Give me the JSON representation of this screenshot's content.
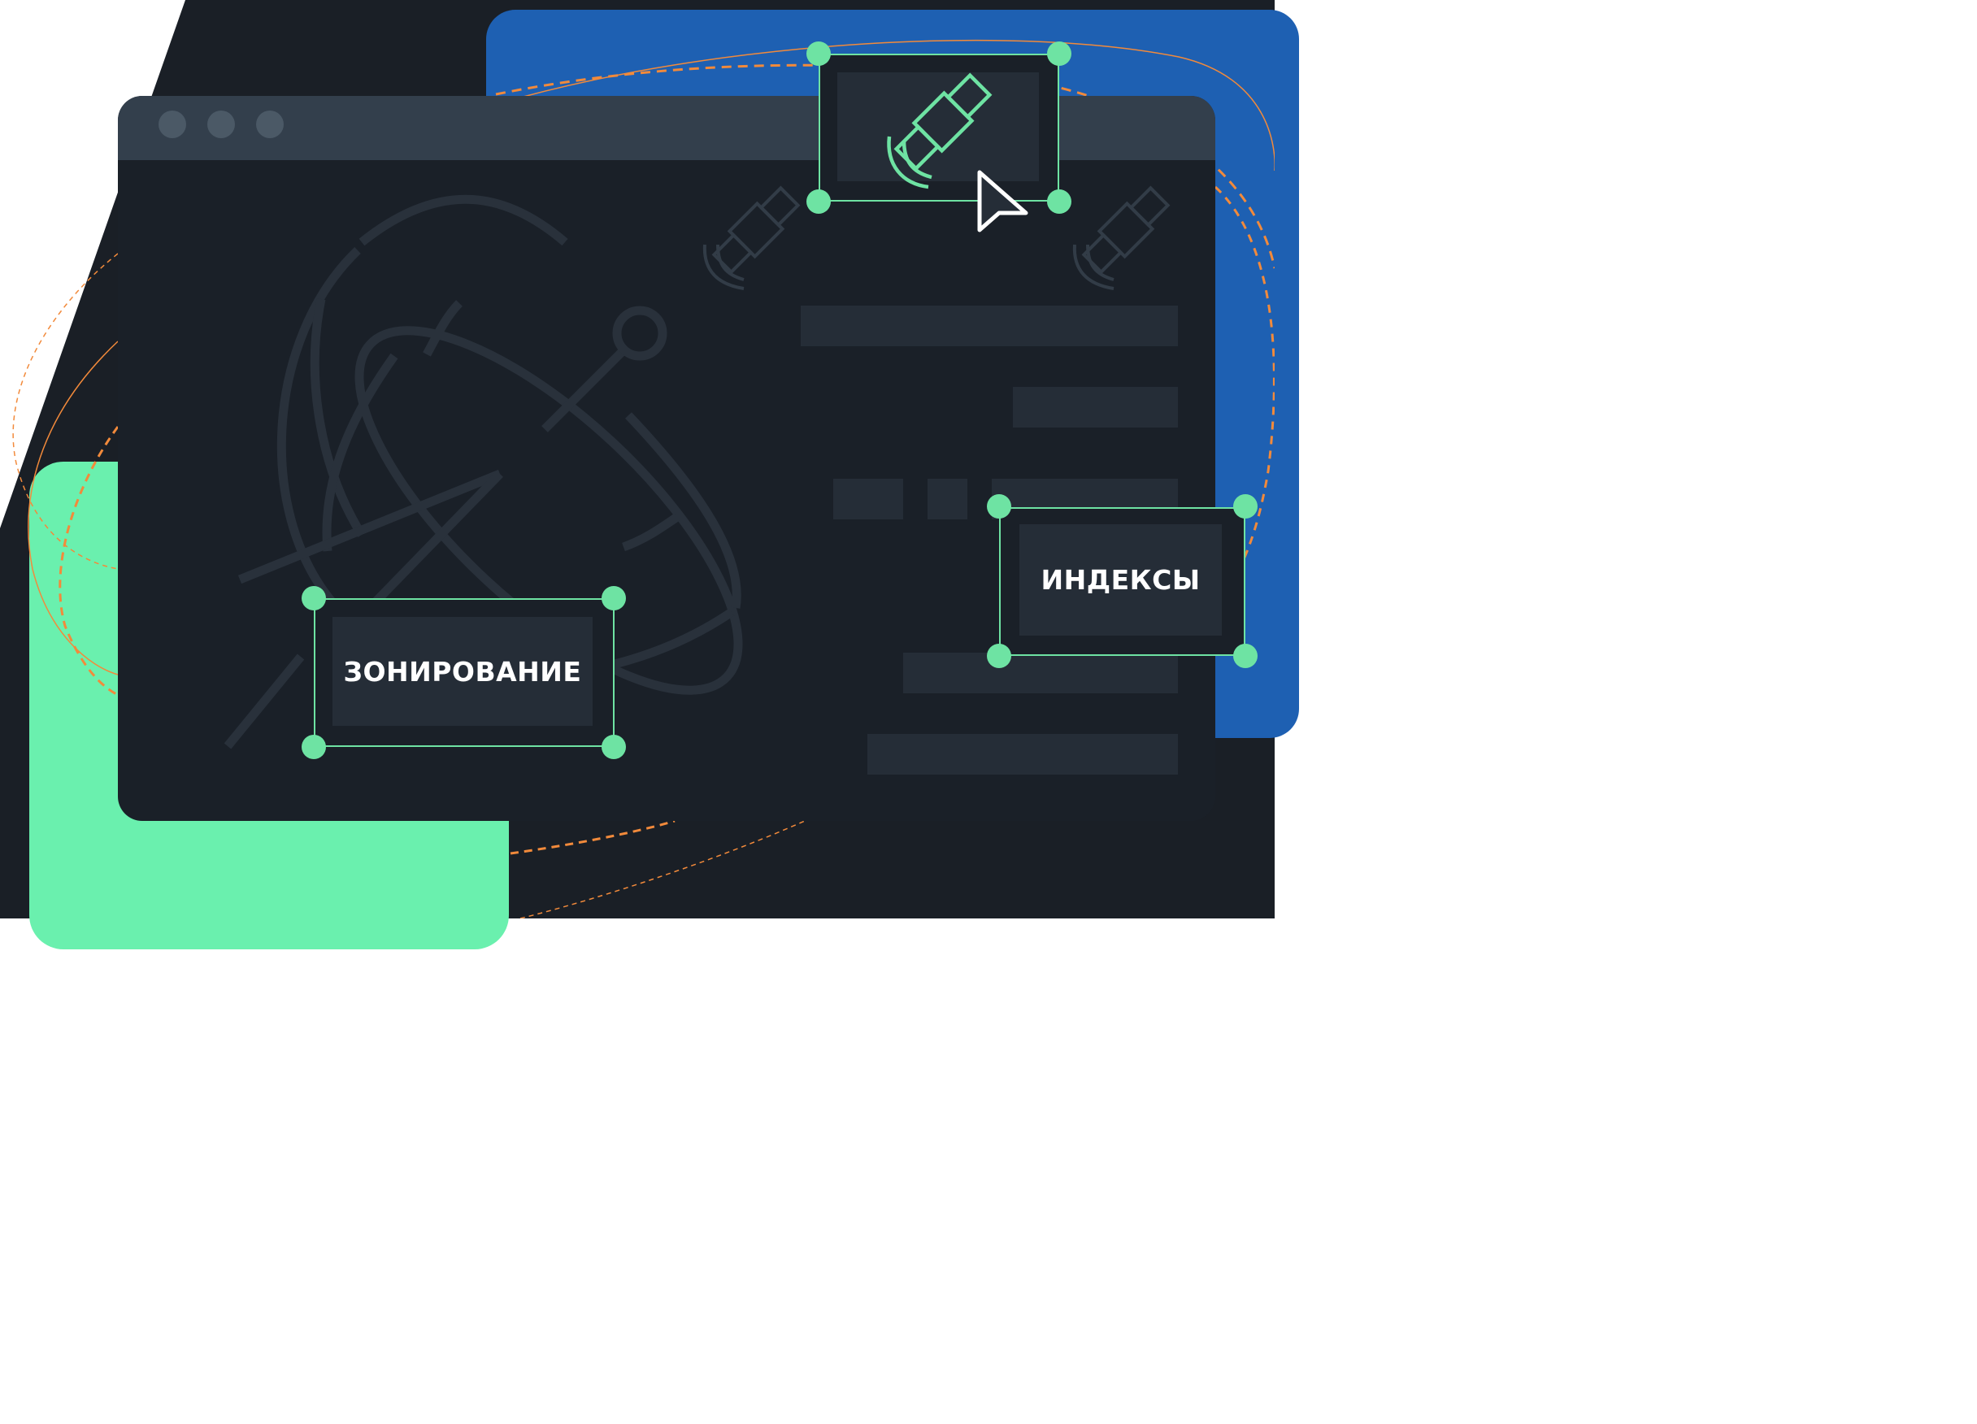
{
  "labels": {
    "zoning": "ЗОНИРОВАНИЕ",
    "indices": "ИНДЕКСЫ"
  },
  "window_controls": [
    "window-dot",
    "window-dot",
    "window-dot"
  ],
  "icons": [
    "satellite-dish-icon",
    "satellite-icon",
    "cursor-icon"
  ],
  "colors": {
    "page_bg": "#ffffff",
    "dark_bg": "#1a1f26",
    "window_bg": "#1a2028",
    "titlebar": "#333f4c",
    "window_dot": "#4b5966",
    "blue_card": "#1e60b2",
    "green_card": "#6af0ae",
    "accent_green": "#6ee3a3",
    "text_block": "#252d37",
    "line_art": "#29313b",
    "orange_dash": "#f28a3b",
    "label_text": "#ffffff"
  }
}
